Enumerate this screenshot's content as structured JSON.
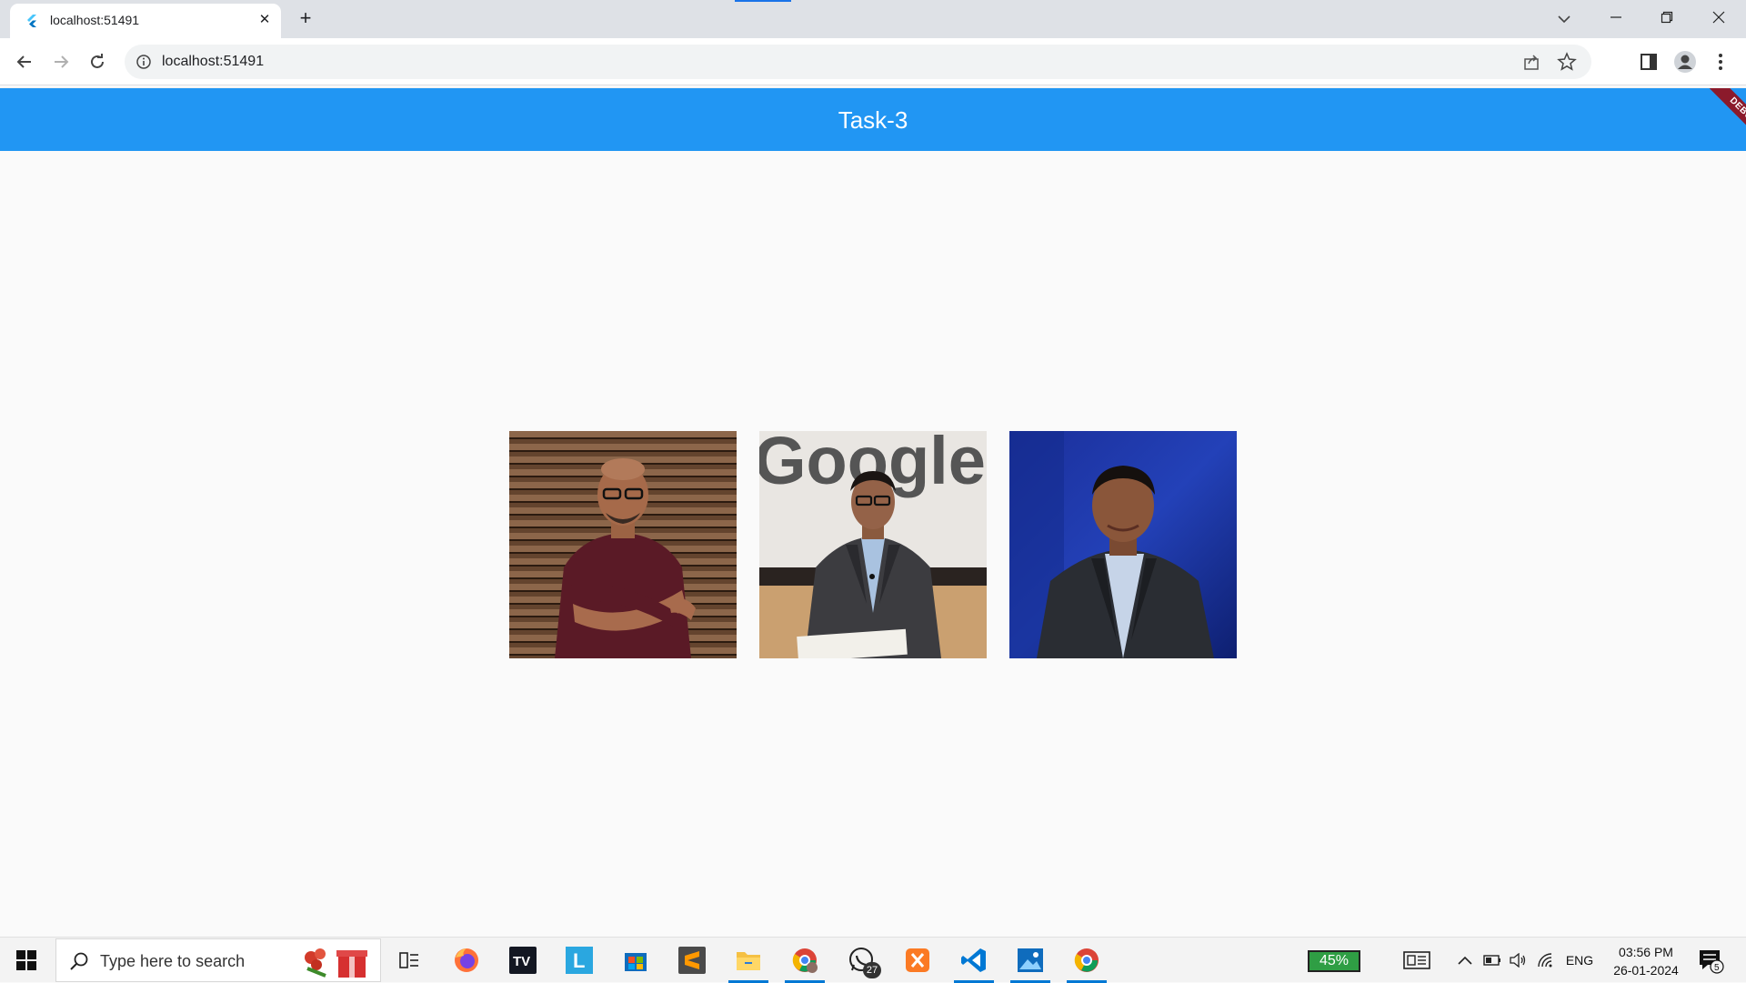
{
  "browser": {
    "tab_title": "localhost:51491",
    "url": "localhost:51491",
    "new_tab_label": "+",
    "close_tab_label": "✕"
  },
  "app": {
    "title": "Task-3",
    "debug_banner": "DEBUG",
    "appbar_color": "#2196f3",
    "photos": [
      {
        "subject": "man in maroon t-shirt with arms crossed, wooden slat background"
      },
      {
        "subject": "man in dark suit in front of Google logo",
        "backdrop_text": "Google"
      },
      {
        "subject": "man in dark suit with light blue shirt, blue background"
      }
    ]
  },
  "taskbar": {
    "search_placeholder": "Type here to search",
    "whatsapp_badge": "27",
    "battery_percent": "45%",
    "language": "ENG",
    "time": "03:56 PM",
    "date": "26-01-2024",
    "notification_count": "5"
  }
}
